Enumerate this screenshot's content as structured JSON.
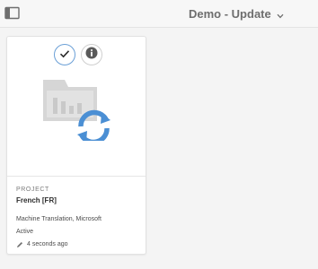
{
  "header": {
    "title": "Demo - Update",
    "rail_toggle_icon": "sidebar-toggle-icon",
    "title_menu_icon": "chevron-down-icon"
  },
  "card": {
    "thumbnail_icon": "translation-project-sync-icon",
    "quick_actions": [
      {
        "name": "select",
        "icon": "checkmark-icon"
      },
      {
        "name": "info",
        "icon": "info-icon"
      }
    ],
    "type": "PROJECT",
    "title": "French [FR]",
    "description": "Machine Translation, Microsoft",
    "status": "Active",
    "modified_icon": "pencil-icon",
    "modified": "4 seconds ago"
  },
  "colors": {
    "accent": "#4b8fd4",
    "select_ring": "#6a9fd6",
    "placeholder_gray": "#d6d6d6"
  }
}
